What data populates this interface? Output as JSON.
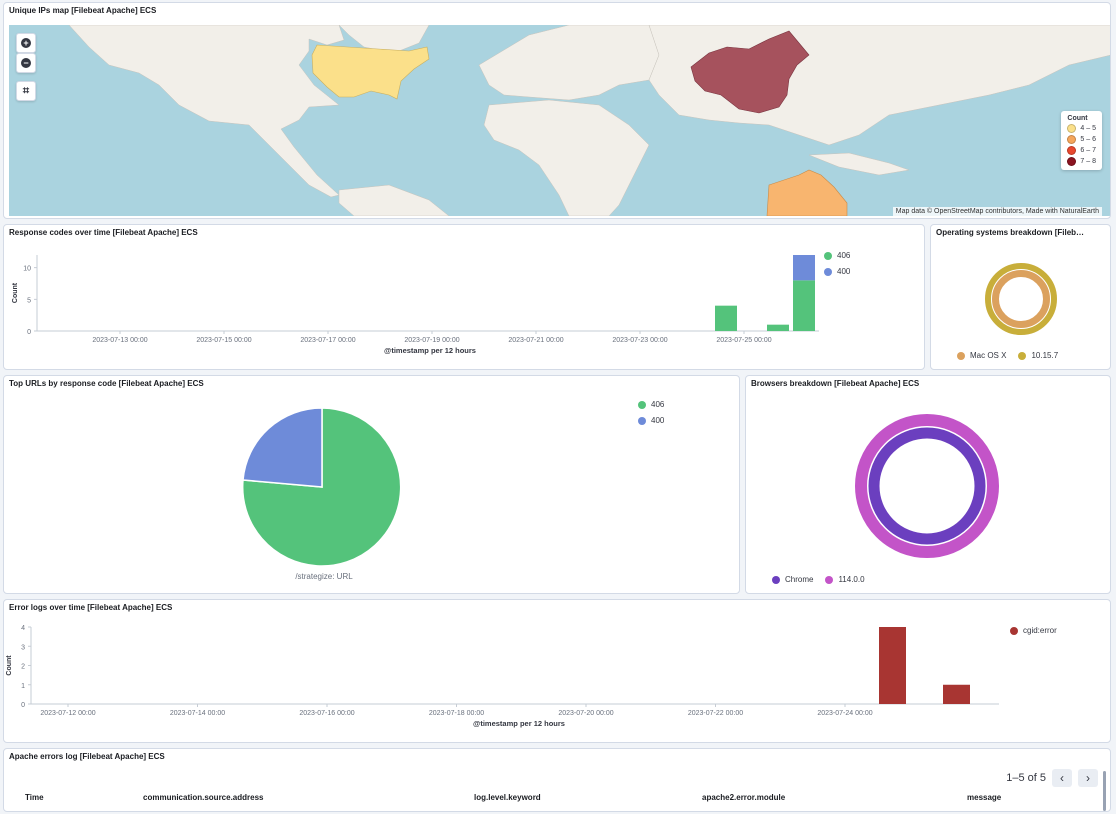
{
  "map_panel": {
    "title": "Unique IPs map [Filebeat Apache] ECS",
    "attribution": "Map data © OpenStreetMap contributors, Made with NaturalEarth",
    "legend_title": "Count",
    "legend_items": [
      {
        "label": "4 – 5",
        "color": "#fbe08a"
      },
      {
        "label": "5 – 6",
        "color": "#f5a65b"
      },
      {
        "label": "6 – 7",
        "color": "#e8482f"
      },
      {
        "label": "7 – 8",
        "color": "#8b1420"
      }
    ],
    "zoom_in_label": "+",
    "zoom_out_label": "−",
    "crop_icon": "crop-icon"
  },
  "response_codes": {
    "title": "Response codes over time [Filebeat Apache] ECS",
    "legend": [
      {
        "label": "406",
        "color": "#54c37b"
      },
      {
        "label": "400",
        "color": "#6e8bd9"
      }
    ]
  },
  "os_panel": {
    "title": "Operating systems breakdown [Filebeat Apache] ECS",
    "legend": [
      {
        "label": "Mac OS X",
        "color": "#dba15e"
      },
      {
        "label": "10.15.7",
        "color": "#c8ae3a"
      }
    ]
  },
  "top_urls": {
    "title": "Top URLs by response code [Filebeat Apache] ECS",
    "caption": "/strategize: URL",
    "legend": [
      {
        "label": "406",
        "color": "#54c37b"
      },
      {
        "label": "400",
        "color": "#6e8bd9"
      }
    ]
  },
  "browsers_panel": {
    "title": "Browsers breakdown [Filebeat Apache] ECS",
    "legend": [
      {
        "label": "Chrome",
        "color": "#6b3fbf"
      },
      {
        "label": "114.0.0",
        "color": "#c354c8"
      }
    ]
  },
  "error_logs": {
    "title": "Error logs over time [Filebeat Apache] ECS",
    "legend": [
      {
        "label": "cgid:error",
        "color": "#a83532"
      }
    ]
  },
  "errors_table": {
    "title": "Apache errors log [Filebeat Apache] ECS",
    "pager_text": "1–5 of 5",
    "columns": [
      "Time",
      "communication.source.address",
      "log.level.keyword",
      "apache2.error.module",
      "message"
    ]
  },
  "chart_data": [
    {
      "type": "bar",
      "title": "Response codes over time [Filebeat Apache] ECS",
      "xlabel": "@timestamp per 12 hours",
      "ylabel": "Count",
      "ylim": [
        0,
        12
      ],
      "yticks": [
        0,
        5,
        10
      ],
      "xtick_labels": [
        "2023-07-13 00:00",
        "2023-07-15 00:00",
        "2023-07-17 00:00",
        "2023-07-19 00:00",
        "2023-07-21 00:00",
        "2023-07-23 00:00",
        "2023-07-25 00:00"
      ],
      "stacked": true,
      "categories": [
        "2023-07-25 00:00",
        "2023-07-26 00:00",
        "2023-07-26 12:00"
      ],
      "series": [
        {
          "name": "406",
          "values": [
            4,
            1,
            8
          ]
        },
        {
          "name": "400",
          "values": [
            0,
            0,
            4
          ]
        }
      ]
    },
    {
      "type": "pie",
      "title": "Operating systems breakdown [Filebeat Apache] ECS",
      "donut": true,
      "rings": [
        {
          "name": "Mac OS X",
          "values": [
            1
          ]
        },
        {
          "name": "10.15.7",
          "values": [
            1
          ]
        }
      ]
    },
    {
      "type": "pie",
      "title": "Top URLs by response code [Filebeat Apache] ECS",
      "caption": "/strategize: URL",
      "series": [
        {
          "name": "406",
          "values": [
            13
          ]
        },
        {
          "name": "400",
          "values": [
            4
          ]
        }
      ]
    },
    {
      "type": "pie",
      "title": "Browsers breakdown [Filebeat Apache] ECS",
      "donut": true,
      "rings": [
        {
          "name": "Chrome",
          "values": [
            1
          ]
        },
        {
          "name": "114.0.0",
          "values": [
            1
          ]
        }
      ]
    },
    {
      "type": "bar",
      "title": "Error logs over time [Filebeat Apache] ECS",
      "xlabel": "@timestamp per 12 hours",
      "ylabel": "Count",
      "ylim": [
        0,
        4
      ],
      "yticks": [
        0,
        1,
        2,
        3,
        4
      ],
      "xtick_labels": [
        "2023-07-12 00:00",
        "2023-07-14 00:00",
        "2023-07-16 00:00",
        "2023-07-18 00:00",
        "2023-07-20 00:00",
        "2023-07-22 00:00",
        "2023-07-24 00:00"
      ],
      "categories": [
        "2023-07-25 00:00",
        "2023-07-26 00:00"
      ],
      "series": [
        {
          "name": "cgid:error",
          "values": [
            4,
            1
          ]
        }
      ]
    }
  ]
}
